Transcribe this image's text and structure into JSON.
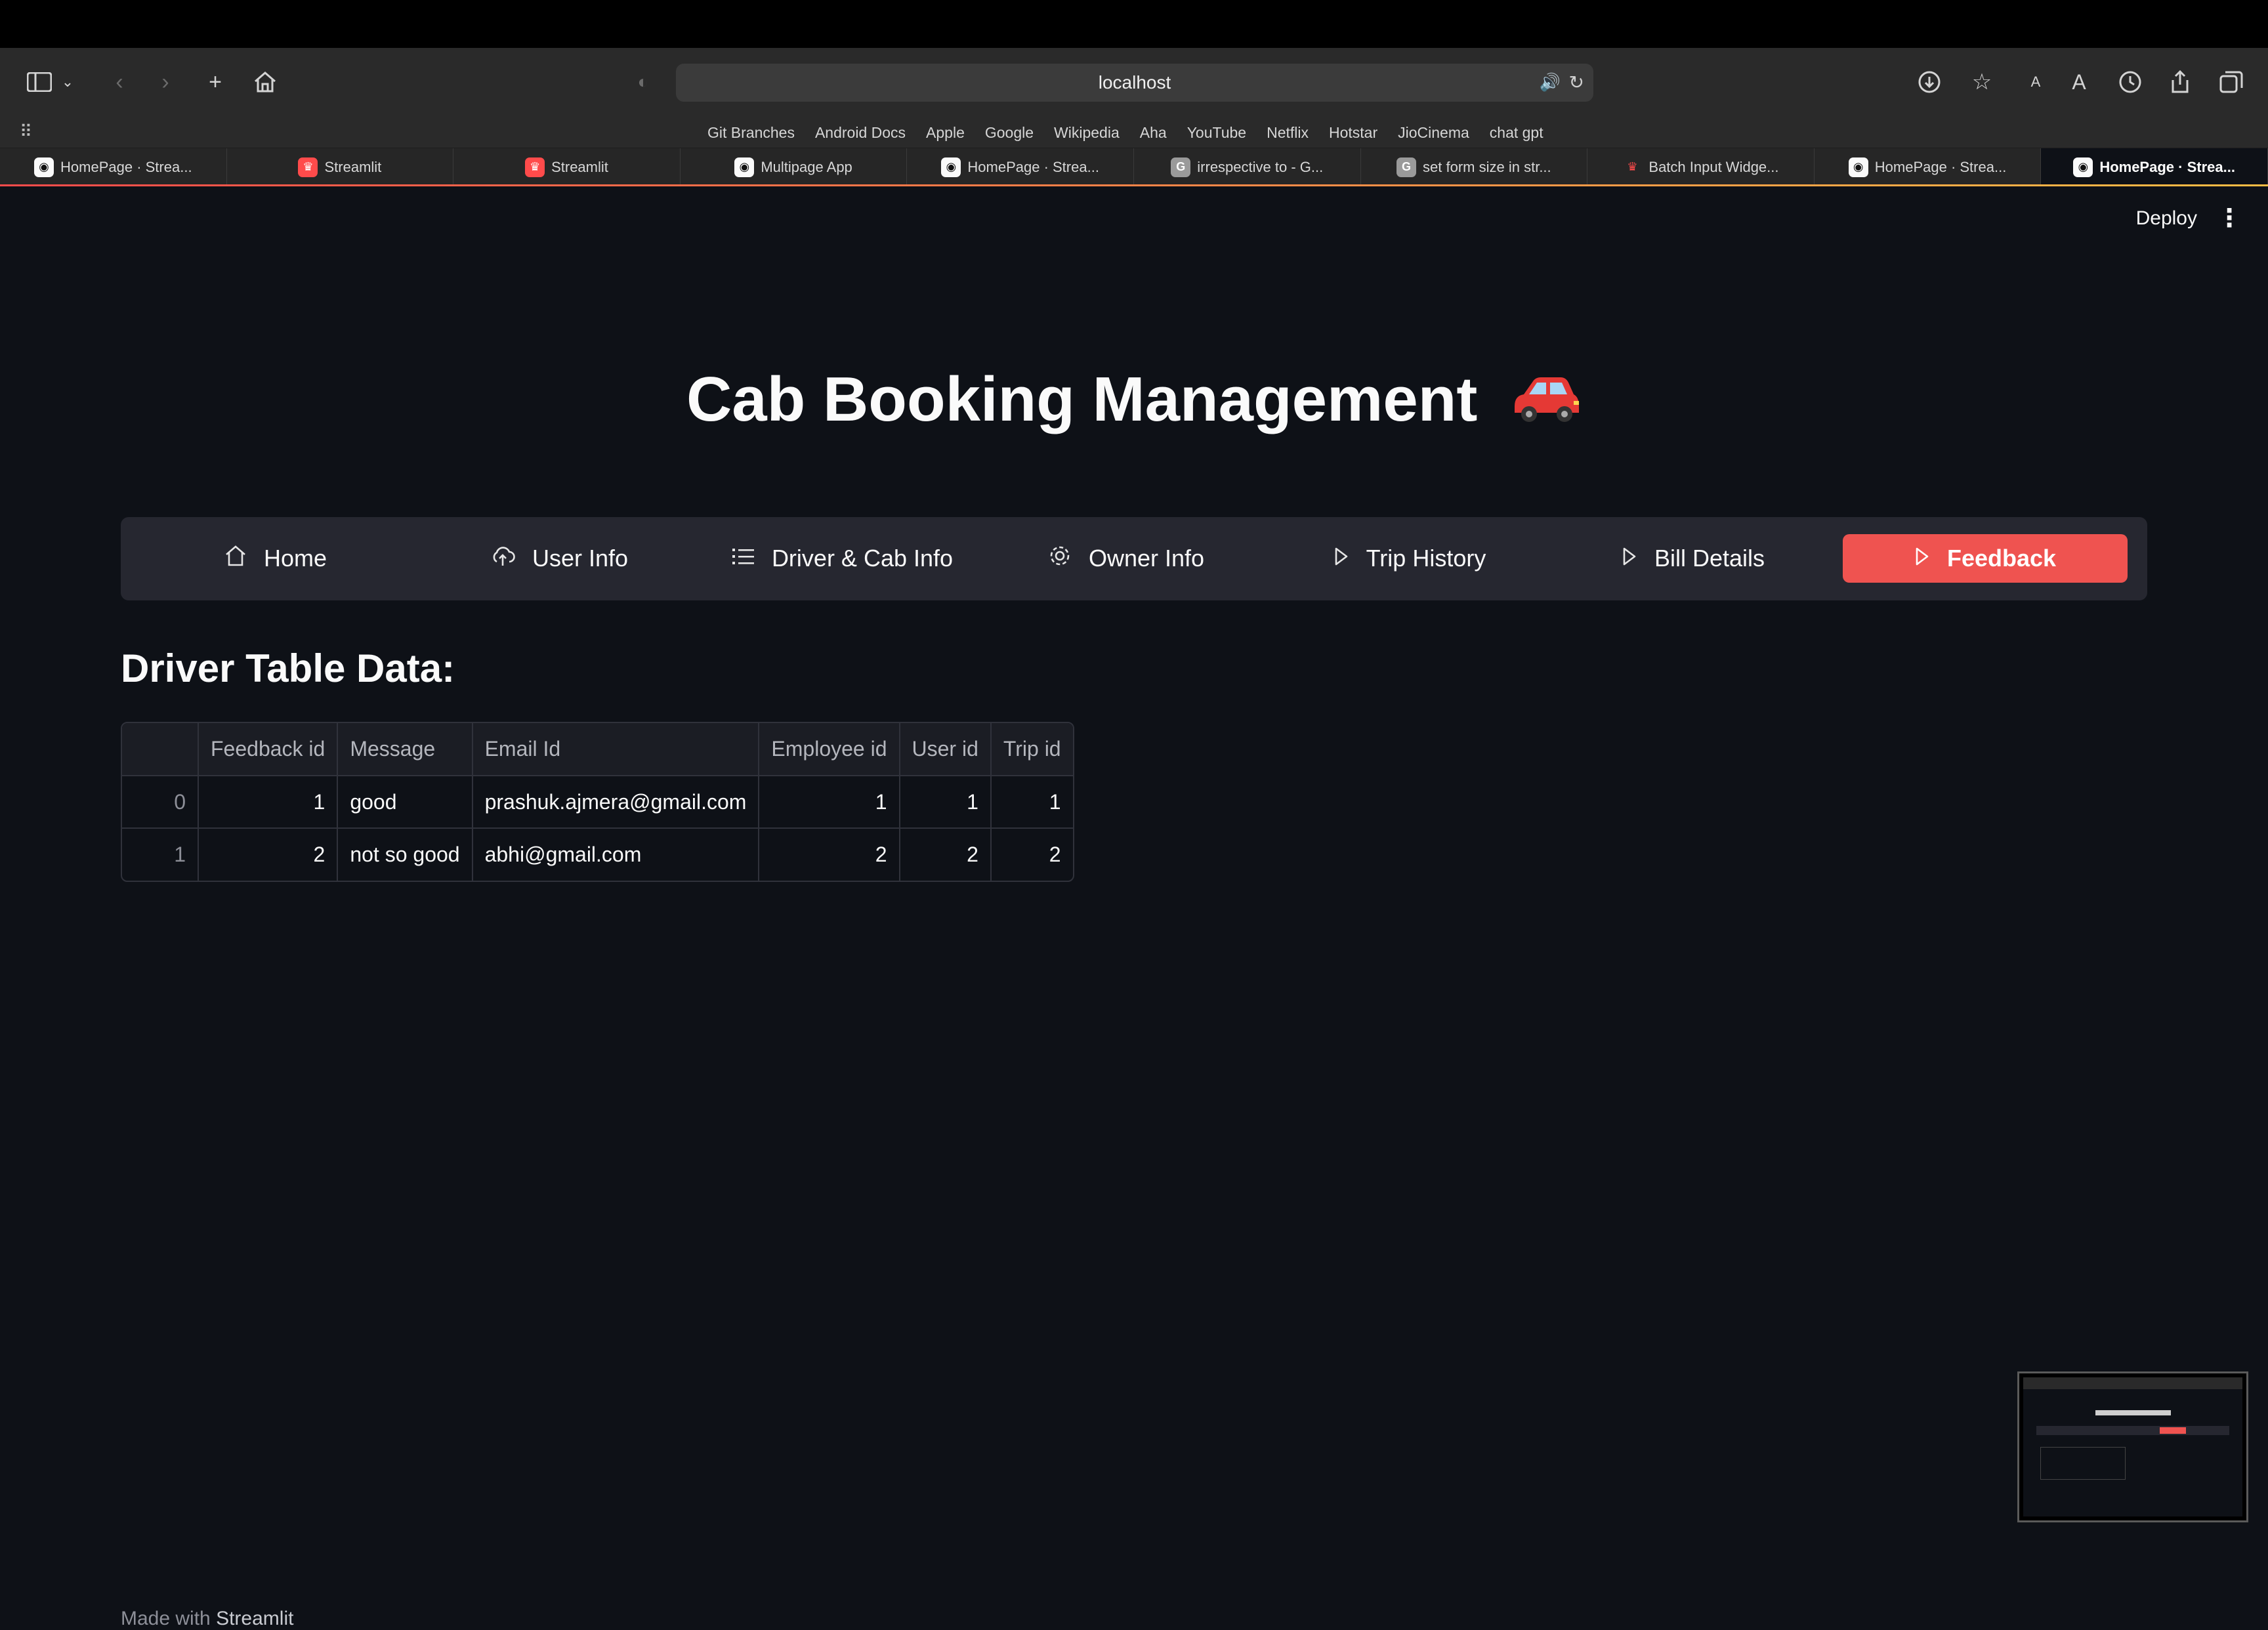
{
  "browser": {
    "address": "localhost",
    "bookmarks": [
      "Git Branches",
      "Android Docs",
      "Apple",
      "Google",
      "Wikipedia",
      "Aha",
      "YouTube",
      "Netflix",
      "Hotstar",
      "JioCinema",
      "chat gpt"
    ],
    "tabs": [
      {
        "label": "HomePage · Strea...",
        "favicon": "streamlit-icon"
      },
      {
        "label": "Streamlit",
        "favicon": "streamlit-red-icon"
      },
      {
        "label": "Streamlit",
        "favicon": "streamlit-red-icon"
      },
      {
        "label": "Multipage App",
        "favicon": "streamlit-icon"
      },
      {
        "label": "HomePage · Strea...",
        "favicon": "streamlit-icon"
      },
      {
        "label": "irrespective to - G...",
        "favicon": "g-icon"
      },
      {
        "label": "set form size in str...",
        "favicon": "g-icon"
      },
      {
        "label": "Batch Input Widge...",
        "favicon": "crown-icon"
      },
      {
        "label": "HomePage · Strea...",
        "favicon": "streamlit-icon"
      },
      {
        "label": "HomePage · Strea...",
        "favicon": "streamlit-icon",
        "active": true
      }
    ]
  },
  "app": {
    "deploy_label": "Deploy",
    "title": "Cab Booking Management",
    "nav": [
      {
        "label": "Home",
        "icon": "home-icon"
      },
      {
        "label": "User Info",
        "icon": "cloud-upload-icon"
      },
      {
        "label": "Driver & Cab Info",
        "icon": "list-icon"
      },
      {
        "label": "Owner Info",
        "icon": "gear-icon"
      },
      {
        "label": "Trip History",
        "icon": "play-icon"
      },
      {
        "label": "Bill Details",
        "icon": "play-icon"
      },
      {
        "label": "Feedback",
        "icon": "play-icon",
        "active": true
      }
    ],
    "section_heading": "Driver Table Data:",
    "table": {
      "columns": [
        "",
        "Feedback id",
        "Message",
        "Email Id",
        "Employee id",
        "User id",
        "Trip id"
      ],
      "rows": [
        [
          "0",
          "1",
          "good",
          "prashuk.ajmera@gmail.com",
          "1",
          "1",
          "1"
        ],
        [
          "1",
          "2",
          "not so good",
          "abhi@gmail.com",
          "2",
          "2",
          "2"
        ]
      ]
    },
    "footer_prefix": "Made with",
    "footer_brand": "Streamlit",
    "accent": "#ef5350",
    "background": "#0e1117"
  }
}
